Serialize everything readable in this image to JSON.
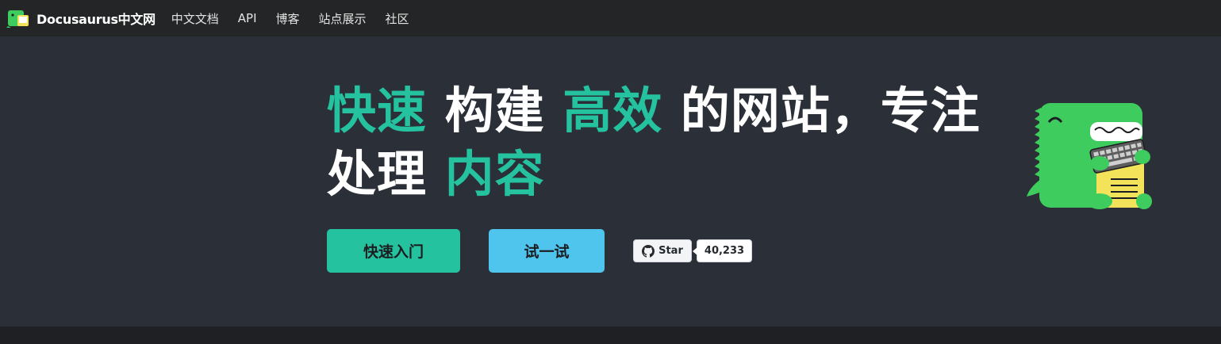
{
  "navbar": {
    "brand_title": "Docusaurus中文网",
    "links": [
      "中文文档",
      "API",
      "博客",
      "站点展示",
      "社区"
    ]
  },
  "hero": {
    "title_parts": [
      "快速",
      " 构建 ",
      "高效",
      " 的网站，专注处理 ",
      "内容"
    ],
    "buttons": {
      "get_started": "快速入门",
      "try_it": "试一试"
    },
    "github": {
      "star_label": "Star",
      "star_count": "40,233"
    }
  },
  "colors": {
    "accent": "#25c2a0",
    "secondary": "#4fc5ee",
    "navbar_bg": "#242526",
    "hero_bg": "#2b2f37"
  },
  "icons": {
    "brand": "docusaurus-dino-logo",
    "github": "github-icon",
    "mascot": "docusaurus-dino-keyboard"
  }
}
